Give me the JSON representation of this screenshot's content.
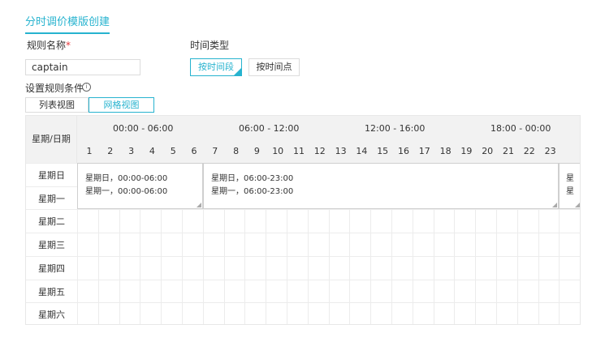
{
  "header": {
    "title": "分时调价模版创建"
  },
  "form": {
    "name_label": "规则名称",
    "required_mark": "*",
    "name_value": "captain",
    "type_label": "时间类型",
    "type_options": [
      "按时间段",
      "按时间点"
    ],
    "type_selected": "按时间段",
    "condition_label": "设置规则条件",
    "info_icon": "info-circle-icon"
  },
  "views": {
    "options": [
      "列表视图",
      "网格视图"
    ],
    "selected": "网格视图"
  },
  "grid": {
    "corner_label": "星期/日期",
    "ranges": [
      "00:00 - 06:00",
      "06:00 - 12:00",
      "12:00 - 16:00",
      "18:00 - 00:00"
    ],
    "hours": [
      "1",
      "2",
      "3",
      "4",
      "5",
      "6",
      "7",
      "8",
      "9",
      "10",
      "11",
      "12",
      "13",
      "14",
      "15",
      "16",
      "17",
      "18",
      "19",
      "20",
      "21",
      "22",
      "23"
    ],
    "days": [
      "星期日",
      "星期一",
      "星期二",
      "星期三",
      "星期四",
      "星期五",
      "星期六"
    ],
    "blocks": [
      {
        "lines": [
          "星期日，00:00-06:00",
          "星期一，00:00-06:00"
        ]
      },
      {
        "lines": [
          "星期日，06:00-23:00",
          "星期一，06:00-23:00"
        ]
      },
      {
        "lines": [
          "星",
          "星"
        ]
      }
    ],
    "accent_color": "#27b3cf"
  }
}
